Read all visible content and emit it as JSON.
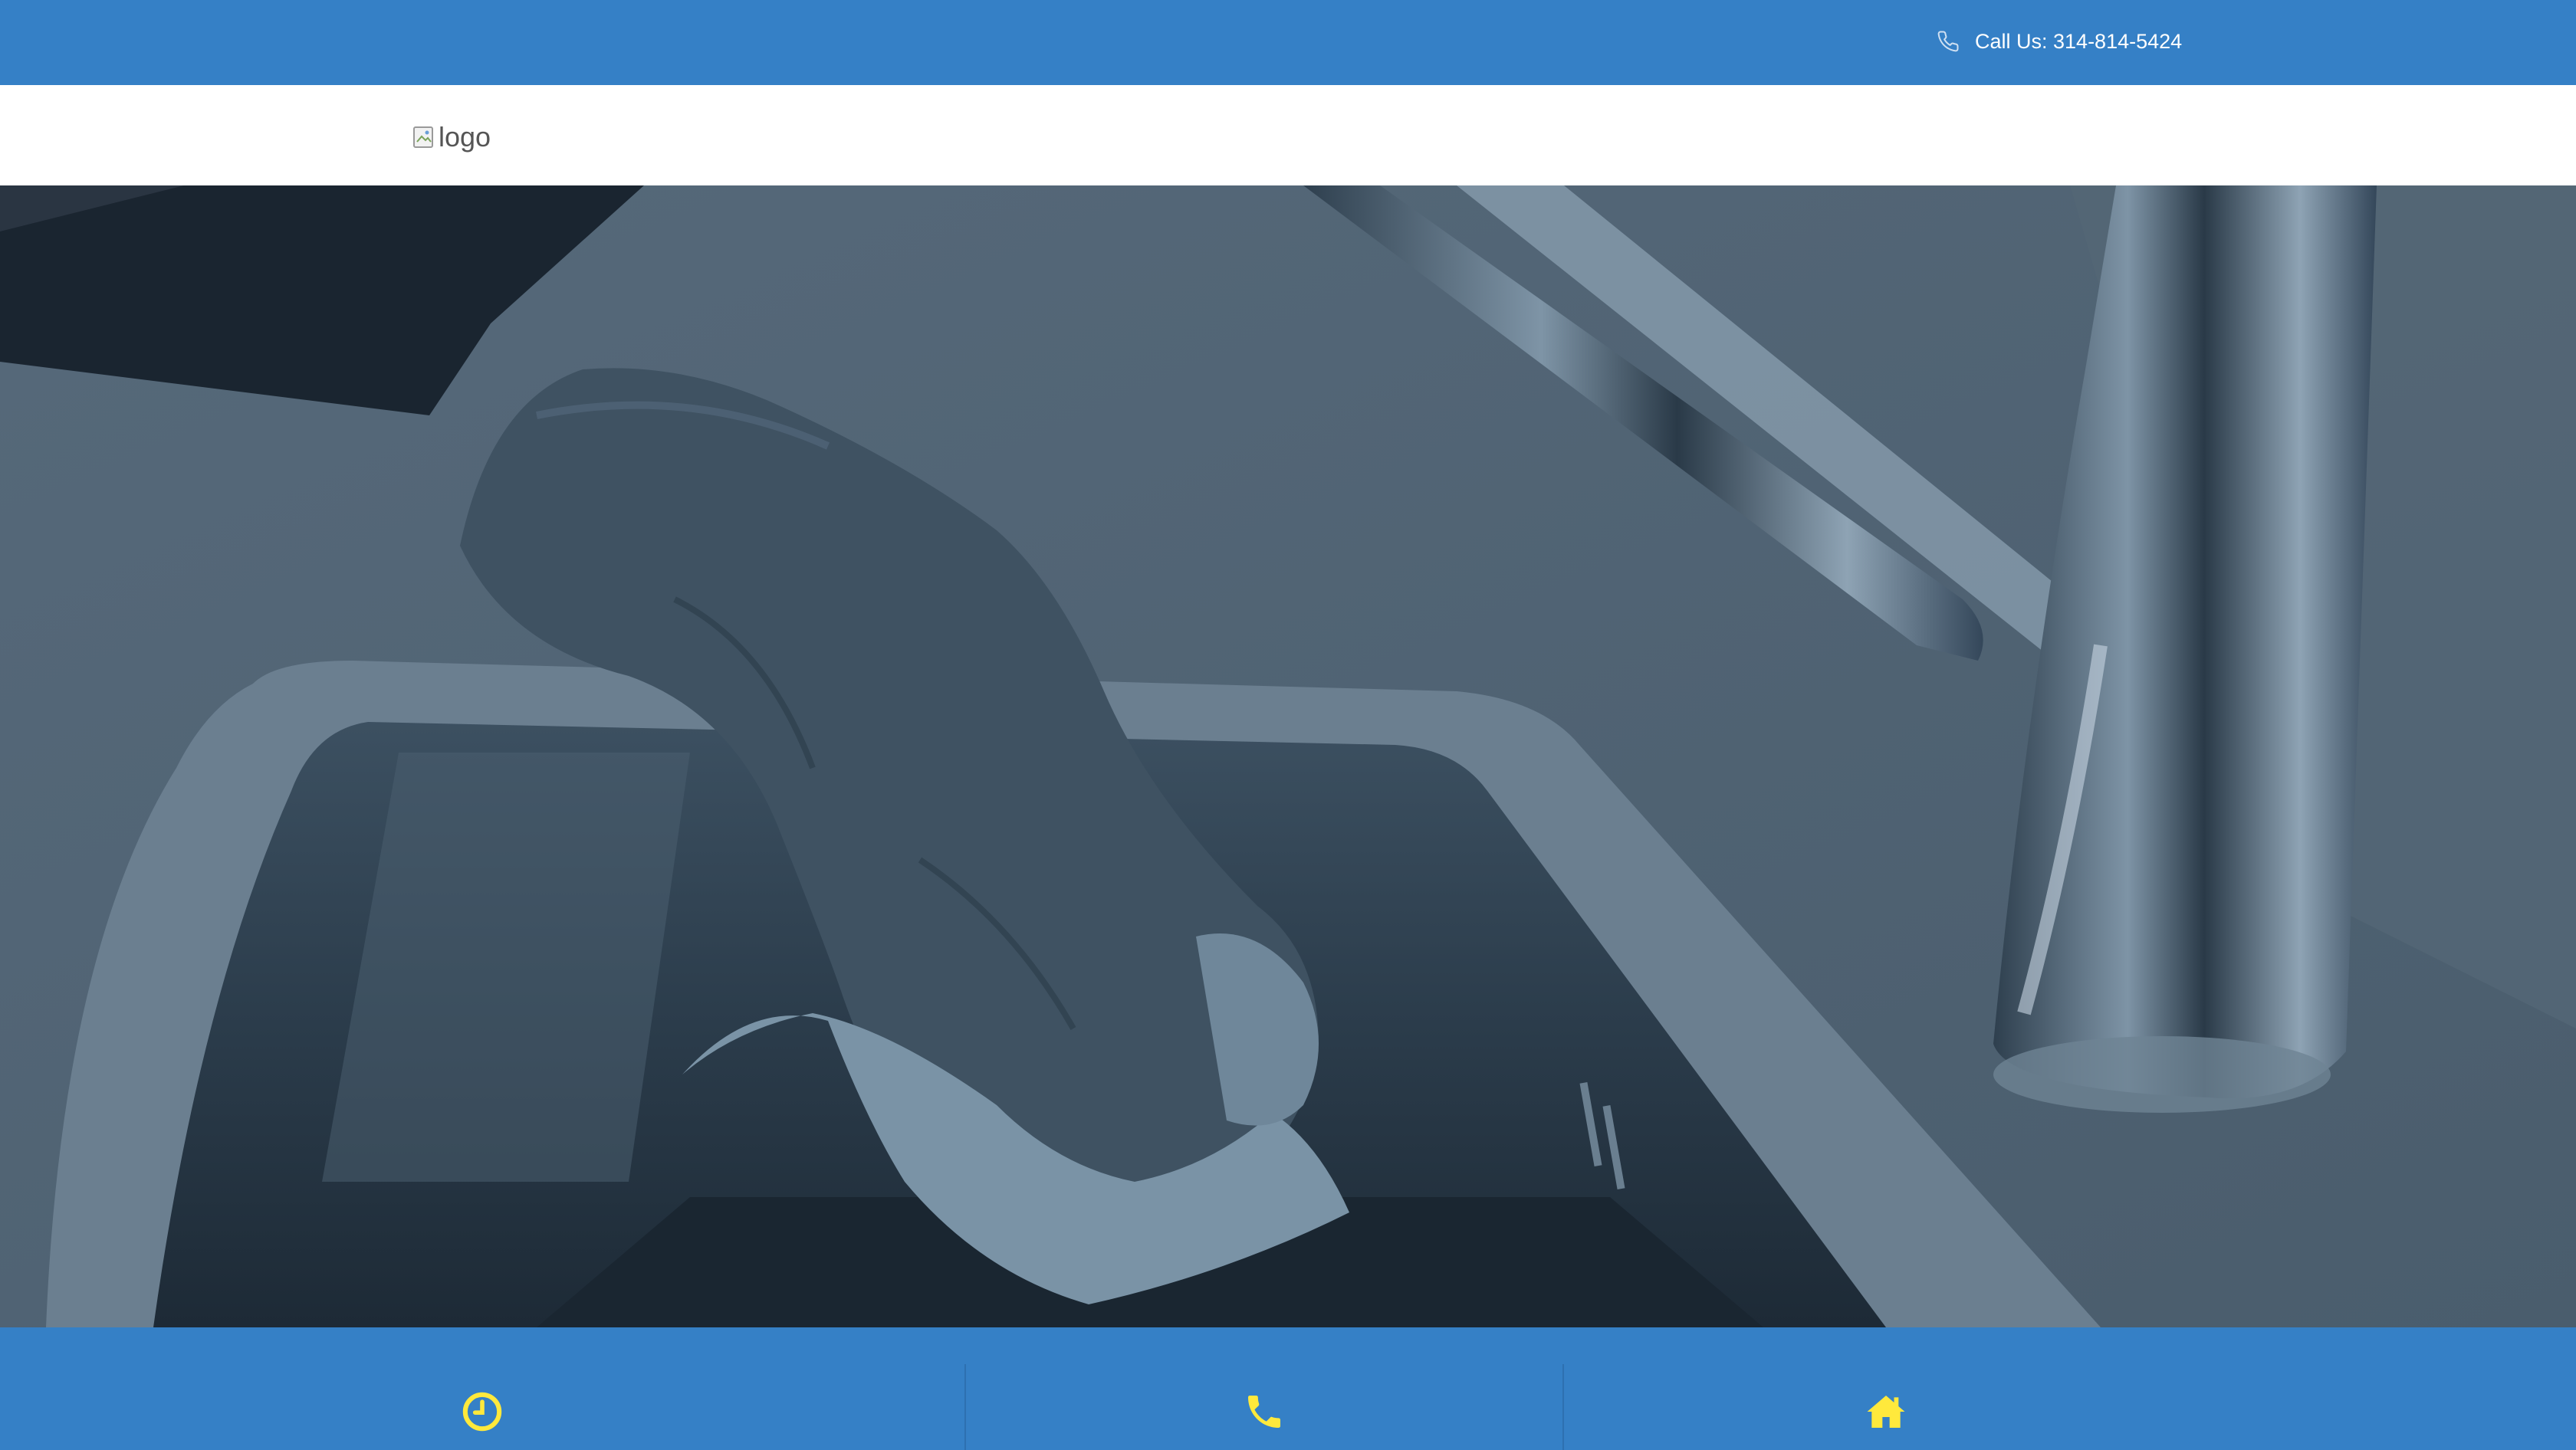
{
  "topbar": {
    "phone_icon": "phone-outline-icon",
    "call_text": "Call Us: 314-814-5424",
    "background": "#3580c6"
  },
  "header": {
    "logo_alt": "logo"
  },
  "hero": {
    "image": "gloved hand cleaning a stainless steel sink",
    "overlay_color": "#3a4c5a"
  },
  "carousel": {
    "slide_count": 8,
    "active_index": 2
  },
  "features": [
    {
      "icon": "clock-icon"
    },
    {
      "icon": "phone-icon"
    },
    {
      "icon": "home-icon"
    }
  ],
  "colors": {
    "accent": "#3580c6",
    "icon_yellow": "#ffe93c"
  }
}
